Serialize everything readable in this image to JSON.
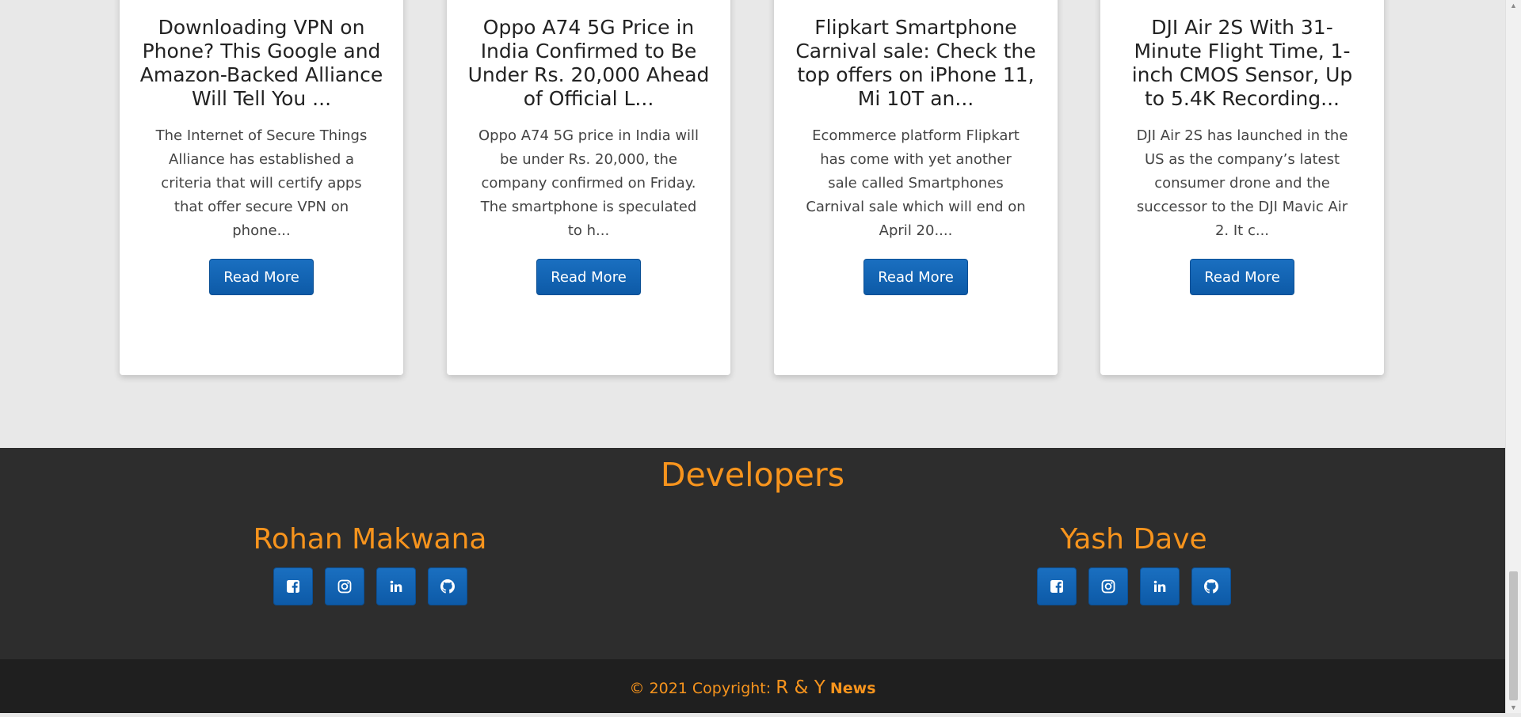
{
  "articles": [
    {
      "title": "Downloading VPN on Phone? This Google and Amazon-Backed Alliance Will Tell You ...",
      "description": "The Internet of Secure Things Alliance has established a criteria that will certify apps that offer secure VPN on phone...",
      "button_label": "Read More"
    },
    {
      "title": "Oppo A74 5G Price in India Confirmed to Be Under Rs. 20,000 Ahead of Official L...",
      "description": "Oppo A74 5G price in India will be under Rs. 20,000, the company confirmed on Friday. The smartphone is speculated to h...",
      "button_label": "Read More"
    },
    {
      "title": "Flipkart Smartphone Carnival sale: Check the top offers on iPhone 11, Mi 10T an...",
      "description": "Ecommerce platform Flipkart has come with yet another sale called Smartphones Carnival sale which will end on April 20....",
      "button_label": "Read More"
    },
    {
      "title": "DJI Air 2S With 31-Minute Flight Time, 1-inch CMOS Sensor, Up to 5.4K Recording...",
      "description": "DJI Air 2S has launched in the US as the company’s latest consumer drone and the successor to the DJI Mavic Air 2. It c...",
      "button_label": "Read More"
    }
  ],
  "developers_section": {
    "heading": "Developers",
    "developers": [
      {
        "name": "Rohan Makwana",
        "socials": [
          "facebook-icon",
          "instagram-icon",
          "linkedin-icon",
          "github-icon"
        ]
      },
      {
        "name": "Yash Dave",
        "socials": [
          "facebook-icon",
          "instagram-icon",
          "linkedin-icon",
          "github-icon"
        ]
      }
    ]
  },
  "footer": {
    "copyright_prefix": "© 2021 Copyright:",
    "brand_letters": "R & Y",
    "brand_word": "News"
  },
  "colors": {
    "accent": "#f7941d",
    "button_blue": "#0d5aa7",
    "footer_dark": "#2d2d2d",
    "copyright_bar": "#1f1f1f",
    "page_bg": "#e8e8e8"
  }
}
